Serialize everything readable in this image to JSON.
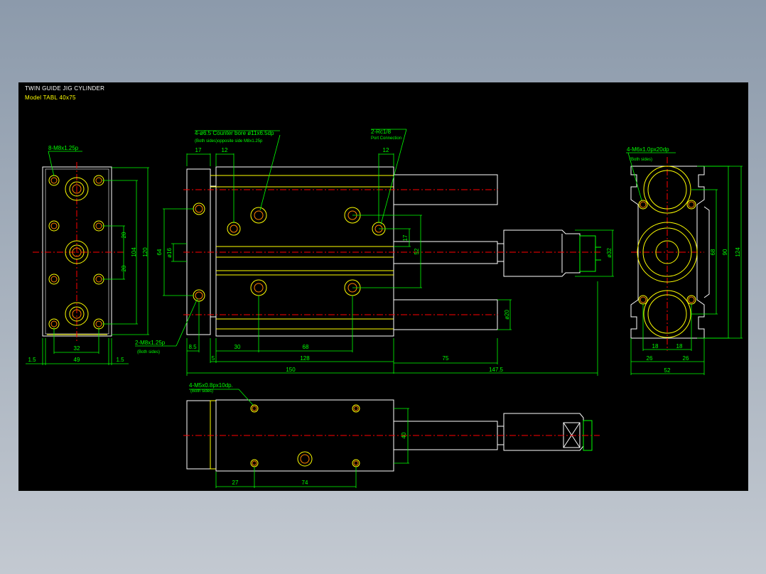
{
  "header": {
    "title": "TWIN GUIDE JIG CYLINDER",
    "model": "Model  TABL 40x75"
  },
  "colors": {
    "background": "#000000",
    "outline": "#ffffff",
    "features": "#ffff00",
    "dimensions": "#00ff00",
    "centerlines": "#ff0000",
    "bore": "#ff8000"
  },
  "callouts": {
    "left_tapped": "8-M8x1.25p",
    "counterbore_1": "4-ø6.5  Counter bore ø11x6.5dp",
    "counterbore_2": "(Both sides)opposite side M8x1.25p",
    "port": "2-Rc1/8",
    "port_sub": "Port Connection",
    "side_tapped": "2-M8x1.25p",
    "side_tapped_sub": "(Both sides)",
    "right_tapped": "4-M6x1.0px20dp",
    "right_tapped_sub": "(Both sides)",
    "bottom_tapped": "4-M5x0.8px10dp.",
    "bottom_tapped_sub": "(Both sides)"
  },
  "dims": {
    "left": [
      "20",
      "20",
      "104",
      "120",
      "32",
      "49",
      "1.5",
      "1.5"
    ],
    "front": [
      "17",
      "12",
      "12",
      "64",
      "ø16",
      "17",
      "52",
      "ø32",
      "ø20",
      "8.5",
      "5",
      "30",
      "68",
      "128",
      "75",
      "150",
      "147.5"
    ],
    "right": [
      "68",
      "90",
      "124",
      "18",
      "18",
      "26",
      "26",
      "52"
    ],
    "bottom": [
      "40",
      "27",
      "74"
    ]
  }
}
